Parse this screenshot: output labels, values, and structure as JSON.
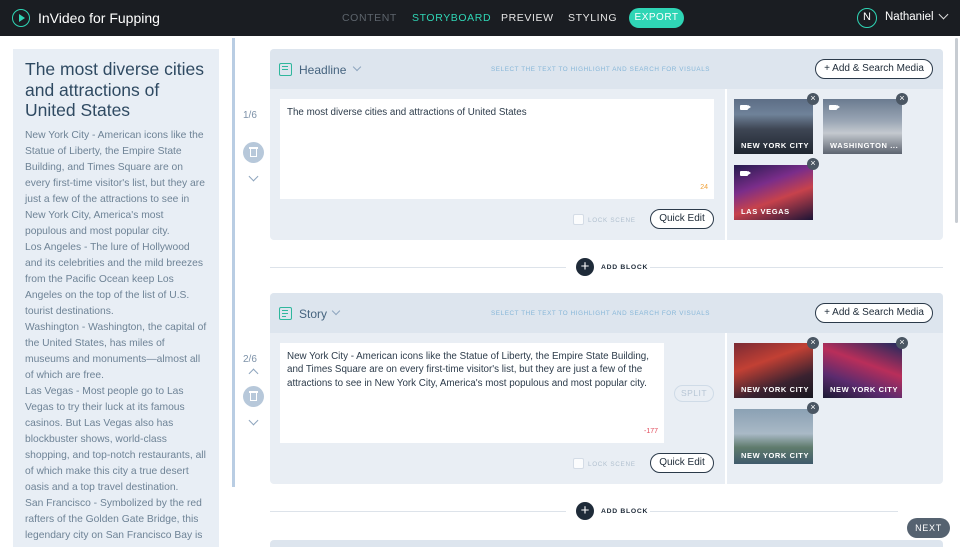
{
  "app": {
    "title": "InVideo for Fupping",
    "logo_icon": "play-circle-icon"
  },
  "nav": {
    "tabs": [
      {
        "label": "CONTENT",
        "state": "inactive"
      },
      {
        "label": "STORYBOARD",
        "state": "active"
      },
      {
        "label": "PREVIEW",
        "state": "normal"
      },
      {
        "label": "STYLING",
        "state": "normal"
      }
    ],
    "export_label": "EXPORT"
  },
  "user": {
    "initial": "N",
    "name": "Nathaniel"
  },
  "script": {
    "title": "The most diverse cities and attractions of United States",
    "paragraphs": [
      "New York City - American icons like the Statue of Liberty, the Empire State Building, and Times Square are on every first-time visitor's list, but they are just a few of the attractions to see in New York City, America's most populous and most popular city.",
      "Los Angeles - The lure of Hollywood and its celebrities and the mild breezes from the Pacific Ocean keep Los Angeles on the top of the list of U.S. tourist destinations.",
      "Washington - Washington, the capital of the United States, has miles of museums and monuments—almost all of which are free.",
      "Las Vegas - Most people go to Las Vegas to try their luck at its famous casinos. But Las Vegas also has blockbuster shows, world-class shopping, and top-notch restaurants, all of which make this city a true desert oasis and a top travel destination.",
      "San Francisco - Symbolized by the red rafters of the Golden Gate Bridge, this legendary city on San Francisco Bay is"
    ]
  },
  "scenes": [
    {
      "index": "1/6",
      "type": "Headline",
      "hint": "SELECT THE TEXT TO HIGHLIGHT AND SEARCH FOR VISUALS",
      "add_media_label": "+ Add & Search Media",
      "text": "The most diverse cities and attractions of United States",
      "char_count": "24",
      "lock_label": "LOCK SCENE",
      "quick_edit_label": "Quick Edit",
      "media": [
        {
          "caption": "NEW YORK CITY",
          "kind": "video"
        },
        {
          "caption": "WASHINGTON ...",
          "kind": "video"
        },
        {
          "caption": "LAS VEGAS",
          "kind": "video"
        }
      ]
    },
    {
      "index": "2/6",
      "type": "Story",
      "hint": "SELECT THE TEXT TO HIGHLIGHT AND SEARCH FOR VISUALS",
      "add_media_label": "+ Add & Search Media",
      "text": "New York City - American icons like the Statue of Liberty, the Empire State Building, and Times Square are on every first-time visitor's list, but they are just a few of the attractions to see in New York City, America's most populous and most popular city.",
      "char_count": "-177",
      "split_label": "SPLIT",
      "lock_label": "LOCK SCENE",
      "quick_edit_label": "Quick Edit",
      "media": [
        {
          "caption": "NEW YORK CITY",
          "kind": "image"
        },
        {
          "caption": "NEW YORK CITY",
          "kind": "image"
        },
        {
          "caption": "NEW YORK CITY",
          "kind": "image"
        }
      ]
    }
  ],
  "add_block_label": "ADD BLOCK",
  "next_label": "NEXT",
  "colors": {
    "accent": "#2fd5b5",
    "topbar": "#1a1d22",
    "panel": "#e8eef5",
    "warning": "#f0a037",
    "error": "#e24a5b"
  }
}
